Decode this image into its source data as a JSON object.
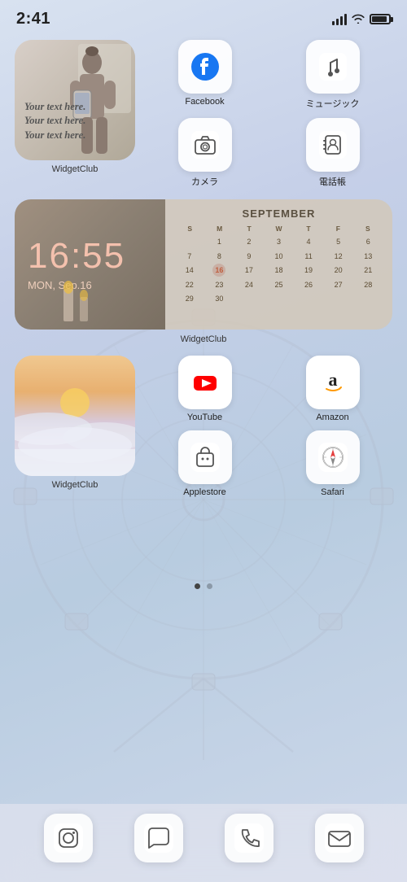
{
  "status": {
    "time": "2:41",
    "battery_label": "battery"
  },
  "widgets": {
    "widget_club_label": "WidgetClub",
    "widget_text_line1": "Your text here.",
    "widget_text_line2": "Your text here.",
    "widget_text_line3": "Your text here.",
    "calendar_time": "16:55",
    "calendar_date": "MON, Sep.16",
    "calendar_month": "SEPTEMBER",
    "calendar_days_header": [
      "S",
      "M",
      "T",
      "W",
      "T",
      "F",
      "S"
    ],
    "calendar_days": [
      "",
      "1",
      "2",
      "3",
      "4",
      "5",
      "6",
      "7",
      "8",
      "9",
      "10",
      "11",
      "12",
      "13",
      "14",
      "15",
      "16",
      "17",
      "18",
      "19",
      "20",
      "21",
      "22",
      "23",
      "24",
      "25",
      "26",
      "27",
      "28",
      "29",
      "30"
    ],
    "calendar_today": "16"
  },
  "apps": {
    "facebook_label": "Facebook",
    "music_label": "ミュージック",
    "camera_label": "カメラ",
    "contacts_label": "電話帳",
    "youtube_label": "YouTube",
    "amazon_label": "Amazon",
    "appstore_label": "Applestore",
    "safari_label": "Safari"
  },
  "dock": {
    "instagram_label": "Instagram",
    "messages_label": "Messages",
    "phone_label": "Phone",
    "mail_label": "Mail"
  },
  "page_dots": {
    "active": 0,
    "count": 2
  }
}
